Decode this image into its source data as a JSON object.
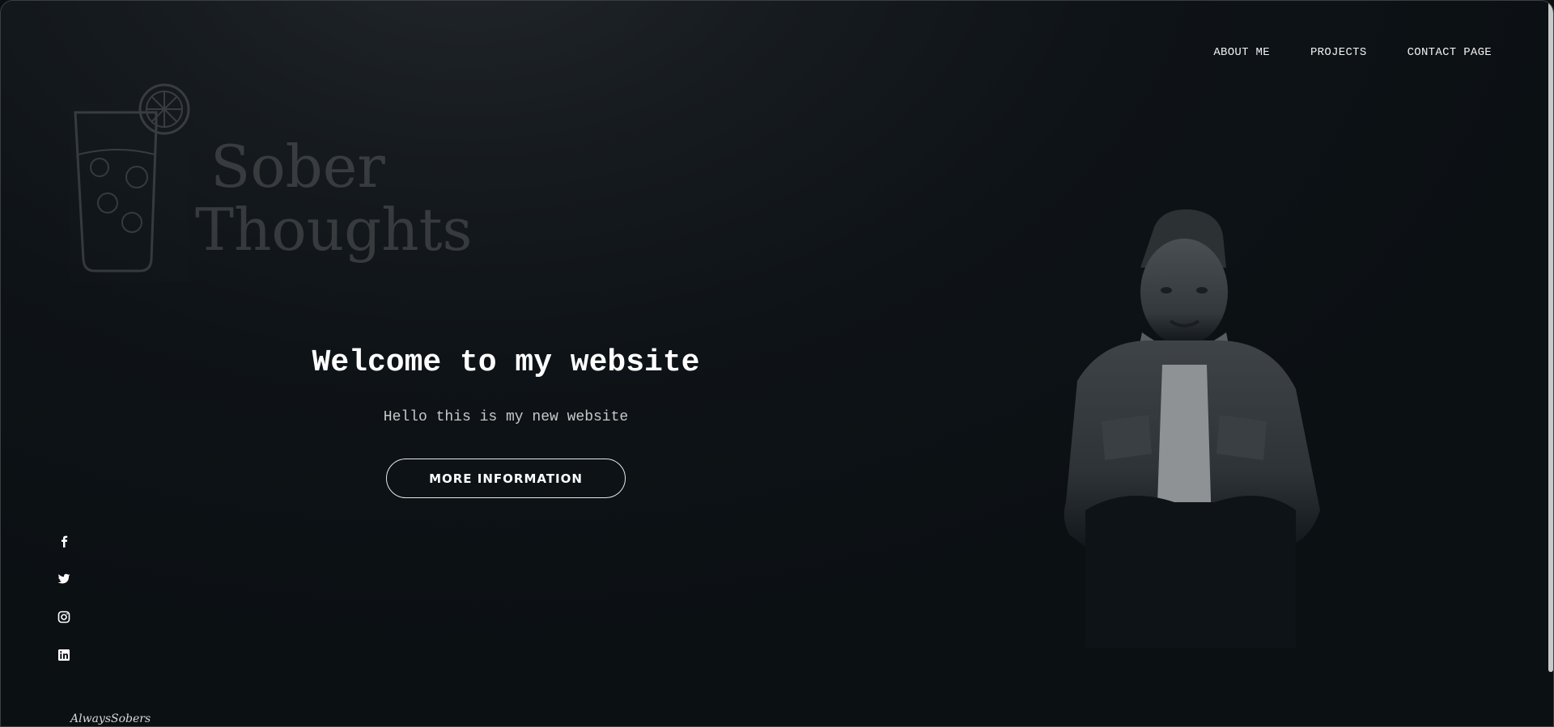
{
  "nav": {
    "items": [
      {
        "label": "ABOUT ME"
      },
      {
        "label": "PROJECTS"
      },
      {
        "label": "CONTACT PAGE"
      }
    ]
  },
  "logo": {
    "line1": "Sober",
    "line2": "Thoughts"
  },
  "hero": {
    "title": "Welcome to my website",
    "subtitle": "Hello this is my new website",
    "button_label": "MORE INFORMATION"
  },
  "social": {
    "icons": [
      "facebook-icon",
      "twitter-icon",
      "instagram-icon",
      "linkedin-icon"
    ]
  },
  "footer": {
    "signature": "AlwaysSobers"
  },
  "colors": {
    "background": "#0b1013",
    "text": "#ffffff",
    "subtext": "#c8c8c8"
  }
}
